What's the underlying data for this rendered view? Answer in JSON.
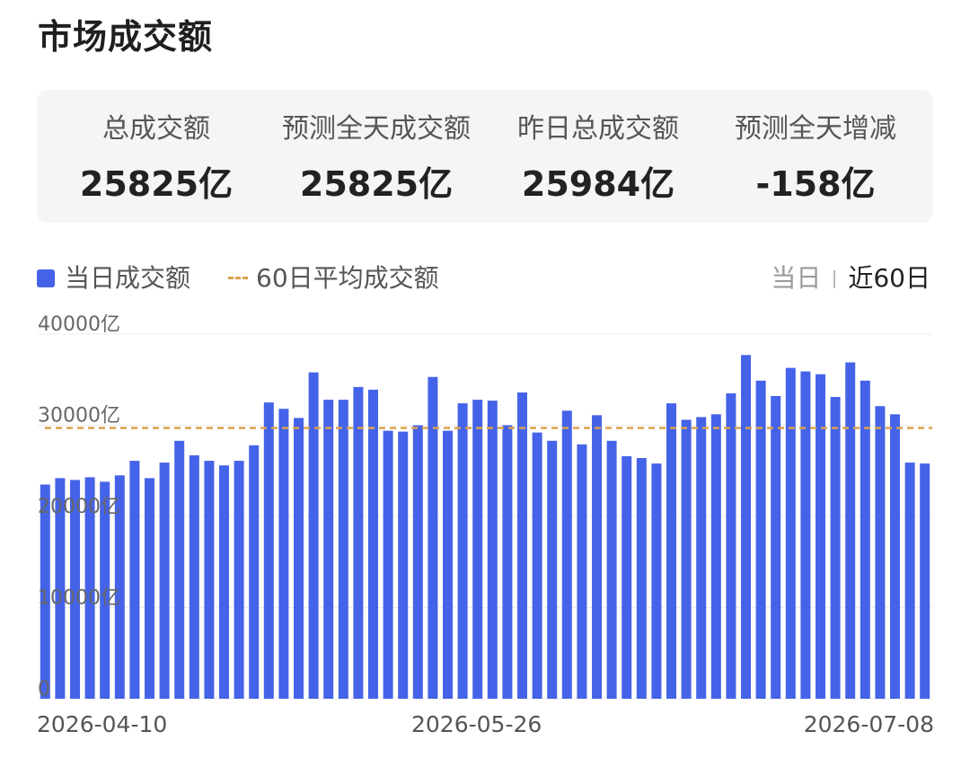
{
  "title": "市场成交额",
  "stats": [
    {
      "label": "总成交额",
      "value": "25825亿"
    },
    {
      "label": "预测全天成交额",
      "value": "25825亿"
    },
    {
      "label": "昨日总成交额",
      "value": "25984亿"
    },
    {
      "label": "预测全天增减",
      "value": "-158亿"
    }
  ],
  "legend": {
    "bar_label": "当日成交额",
    "line_label": "60日平均成交额"
  },
  "toggle": {
    "today": "当日",
    "last60": "近60日"
  },
  "colors": {
    "bar": "#4563e8",
    "avg_line": "#d9a24c"
  },
  "chart_data": {
    "type": "bar",
    "ylim": [
      0,
      40000
    ],
    "yticks": [
      "0",
      "10000亿",
      "20000亿",
      "30000亿",
      "40000亿"
    ],
    "x_start": "2026-04-10",
    "x_mid": "2026-05-26",
    "x_end": "2026-07-08",
    "average": 29700,
    "values": [
      23500,
      24200,
      24000,
      24300,
      23800,
      24500,
      26100,
      24200,
      25900,
      28300,
      26700,
      26100,
      25600,
      26100,
      27800,
      32500,
      31800,
      30800,
      35800,
      32800,
      32800,
      34200,
      33900,
      29400,
      29300,
      30000,
      35300,
      29400,
      32400,
      32800,
      32700,
      30000,
      33600,
      29200,
      28300,
      31600,
      27900,
      31100,
      28300,
      26600,
      26400,
      25800,
      32400,
      30600,
      30900,
      31200,
      33500,
      37700,
      34900,
      33200,
      36300,
      35900,
      35600,
      33100,
      36900,
      34900,
      32100,
      31200,
      25900,
      25800
    ]
  }
}
